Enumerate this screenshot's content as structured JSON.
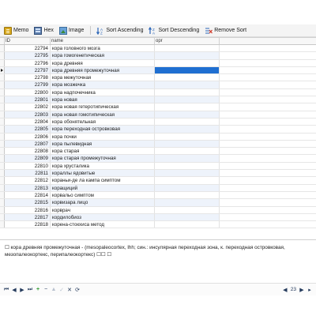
{
  "toolbar": {
    "memo": "Memo",
    "hex": "Hex",
    "image": "Image",
    "sort_asc": "Sort Ascending",
    "sort_desc": "Sort Descending",
    "remove_sort": "Remove Sort"
  },
  "grid": {
    "columns": [
      "ID",
      "name",
      "opr"
    ],
    "selected_row_index": 3,
    "rows": [
      {
        "id": "22794",
        "name": "кора головного мозга"
      },
      {
        "id": "22795",
        "name": "кора гомогенетическая"
      },
      {
        "id": "22796",
        "name": "кора древняя"
      },
      {
        "id": "22797",
        "name": "кора древняя промежуточная"
      },
      {
        "id": "22798",
        "name": "кора межуточная"
      },
      {
        "id": "22799",
        "name": "кора мозжечка"
      },
      {
        "id": "22800",
        "name": "кора надпочечника"
      },
      {
        "id": "22801",
        "name": "кора новая"
      },
      {
        "id": "22802",
        "name": "кора новая гетеротипическая"
      },
      {
        "id": "22803",
        "name": "кора новая гомотипическая"
      },
      {
        "id": "22804",
        "name": "кора обонятельная"
      },
      {
        "id": "22805",
        "name": "кора переходная островковая"
      },
      {
        "id": "22806",
        "name": "кора почки"
      },
      {
        "id": "22807",
        "name": "кора пылевидная"
      },
      {
        "id": "22808",
        "name": "кора старая"
      },
      {
        "id": "22809",
        "name": "кора старая промежуточная"
      },
      {
        "id": "22810",
        "name": "кора хрусталика"
      },
      {
        "id": "22811",
        "name": "кораллы ядовитые"
      },
      {
        "id": "22812",
        "name": "кораньи-де ла кампа симптом"
      },
      {
        "id": "22813",
        "name": "коращиций"
      },
      {
        "id": "22814",
        "name": "корвальо симптом"
      },
      {
        "id": "22815",
        "name": "корвизара лицо"
      },
      {
        "id": "22816",
        "name": "корврач"
      },
      {
        "id": "22817",
        "name": "кордилобиоз"
      },
      {
        "id": "22818",
        "name": "корена-стокхиса метод"
      }
    ]
  },
  "memo": {
    "text": "☐ кора древняя промежуточная - (mesopaleocortex, lhh; син.: инсулярная переходная зона, к. переходная островковая, мезопалеокортекс, перипалеокортекс) ☐☐ ☐"
  },
  "nav": {
    "page": "23",
    "buttons": [
      "first-record-icon",
      "prior-record-icon",
      "next-record-icon",
      "last-record-icon",
      "insert-record-icon",
      "delete-record-icon",
      "edit-record-icon",
      "post-edit-icon",
      "cancel-edit-icon",
      "refresh-icon",
      "prev-page-icon",
      "next-page-icon"
    ]
  },
  "colors": {
    "selection": "#1f6fd1",
    "alt_row": "#eef3fb",
    "nav_icon": "#243a5c",
    "add_icon": "#2f9a2f"
  }
}
